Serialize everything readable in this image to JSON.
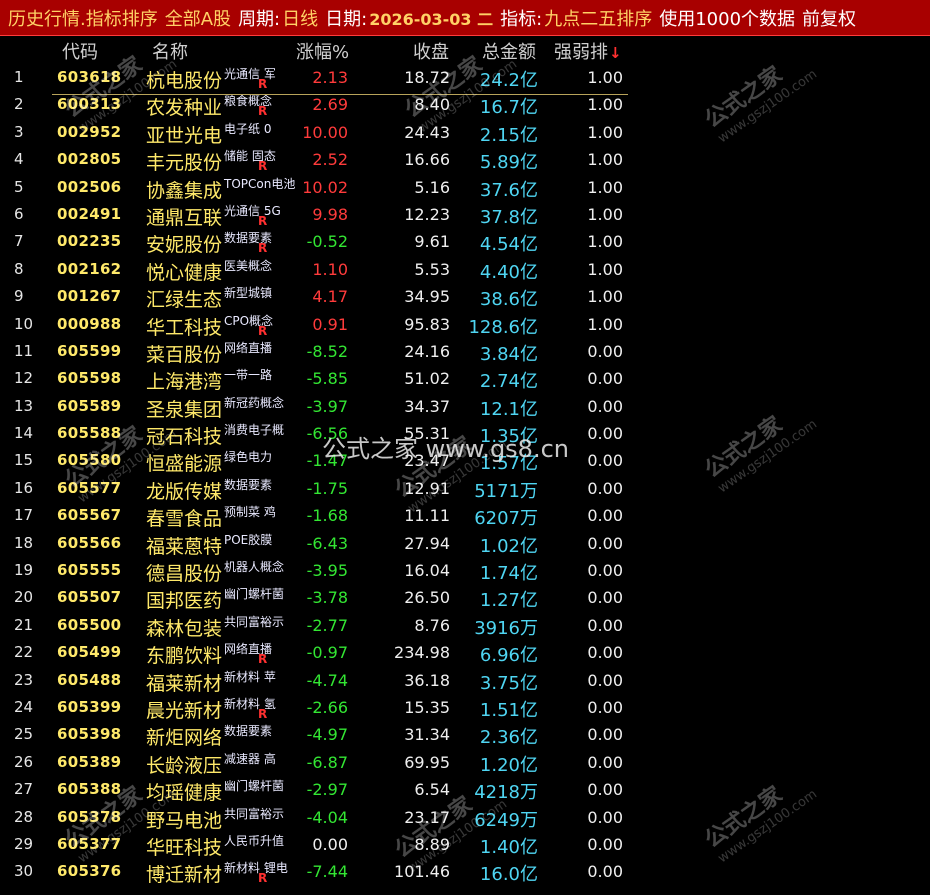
{
  "titlebar": {
    "title": "历史行情.指标排序",
    "market": "全部A股",
    "period_label": "周期:",
    "period_value": "日线",
    "date_label": "日期:",
    "date_value": "2026-03-03 二",
    "indicator_label": "指标:",
    "indicator_value": "九点二五排序",
    "data_note": "使用1000个数据",
    "adjust": "前复权"
  },
  "columns": {
    "code": "代码",
    "name": "名称",
    "change": "涨幅%",
    "close": "收盘",
    "amount": "总金额",
    "strength": "强弱排",
    "sort_arrow": "↓"
  },
  "watermark": {
    "center": "公式之家 www.gs8.cn",
    "mark_big": "公式之家",
    "mark_small": "www.gszj100.com"
  },
  "rows": [
    {
      "num": "1",
      "code": "603618",
      "name": "杭电股份",
      "concept": "光通信 军",
      "r": true,
      "change": "2.13",
      "close": "18.72",
      "amount": "24.2亿",
      "strength": "1.00",
      "dir": "up"
    },
    {
      "num": "2",
      "code": "600313",
      "name": "农发种业",
      "concept": "粮食概念",
      "r": true,
      "change": "2.69",
      "close": "8.40",
      "amount": "16.7亿",
      "strength": "1.00",
      "dir": "up"
    },
    {
      "num": "3",
      "code": "002952",
      "name": "亚世光电",
      "concept": "电子纸 0",
      "r": false,
      "change": "10.00",
      "close": "24.43",
      "amount": "2.15亿",
      "strength": "1.00",
      "dir": "up"
    },
    {
      "num": "4",
      "code": "002805",
      "name": "丰元股份",
      "concept": "储能 固态",
      "r": true,
      "change": "2.52",
      "close": "16.66",
      "amount": "5.89亿",
      "strength": "1.00",
      "dir": "up"
    },
    {
      "num": "5",
      "code": "002506",
      "name": "协鑫集成",
      "concept": "TOPCon电池",
      "r": false,
      "change": "10.02",
      "close": "5.16",
      "amount": "37.6亿",
      "strength": "1.00",
      "dir": "up"
    },
    {
      "num": "6",
      "code": "002491",
      "name": "通鼎互联",
      "concept": "光通信 5G",
      "r": true,
      "change": "9.98",
      "close": "12.23",
      "amount": "37.8亿",
      "strength": "1.00",
      "dir": "up"
    },
    {
      "num": "7",
      "code": "002235",
      "name": "安妮股份",
      "concept": "数据要素",
      "r": true,
      "change": "-0.52",
      "close": "9.61",
      "amount": "4.54亿",
      "strength": "1.00",
      "dir": "down"
    },
    {
      "num": "8",
      "code": "002162",
      "name": "悦心健康",
      "concept": "医美概念",
      "r": false,
      "change": "1.10",
      "close": "5.53",
      "amount": "4.40亿",
      "strength": "1.00",
      "dir": "up"
    },
    {
      "num": "9",
      "code": "001267",
      "name": "汇绿生态",
      "concept": "新型城镇",
      "r": false,
      "change": "4.17",
      "close": "34.95",
      "amount": "38.6亿",
      "strength": "1.00",
      "dir": "up"
    },
    {
      "num": "10",
      "code": "000988",
      "name": "华工科技",
      "concept": "CPO概念",
      "r": true,
      "change": "0.91",
      "close": "95.83",
      "amount": "128.6亿",
      "strength": "1.00",
      "dir": "up"
    },
    {
      "num": "11",
      "code": "605599",
      "name": "菜百股份",
      "concept": "网络直播",
      "r": false,
      "change": "-8.52",
      "close": "24.16",
      "amount": "3.84亿",
      "strength": "0.00",
      "dir": "down"
    },
    {
      "num": "12",
      "code": "605598",
      "name": "上海港湾",
      "concept": "一带一路",
      "r": false,
      "change": "-5.85",
      "close": "51.02",
      "amount": "2.74亿",
      "strength": "0.00",
      "dir": "down"
    },
    {
      "num": "13",
      "code": "605589",
      "name": "圣泉集团",
      "concept": "新冠药概念",
      "r": false,
      "change": "-3.97",
      "close": "34.37",
      "amount": "12.1亿",
      "strength": "0.00",
      "dir": "down"
    },
    {
      "num": "14",
      "code": "605588",
      "name": "冠石科技",
      "concept": "消费电子概",
      "r": false,
      "change": "-6.56",
      "close": "55.31",
      "amount": "1.35亿",
      "strength": "0.00",
      "dir": "down"
    },
    {
      "num": "15",
      "code": "605580",
      "name": "恒盛能源",
      "concept": "绿色电力",
      "r": false,
      "change": "-1.47",
      "close": "23.47",
      "amount": "1.57亿",
      "strength": "0.00",
      "dir": "down"
    },
    {
      "num": "16",
      "code": "605577",
      "name": "龙版传媒",
      "concept": "数据要素",
      "r": false,
      "change": "-1.75",
      "close": "12.91",
      "amount": "5171万",
      "strength": "0.00",
      "dir": "down"
    },
    {
      "num": "17",
      "code": "605567",
      "name": "春雪食品",
      "concept": "预制菜 鸡",
      "r": false,
      "change": "-1.68",
      "close": "11.11",
      "amount": "6207万",
      "strength": "0.00",
      "dir": "down"
    },
    {
      "num": "18",
      "code": "605566",
      "name": "福莱蒽特",
      "concept": "POE胶膜",
      "r": false,
      "change": "-6.43",
      "close": "27.94",
      "amount": "1.02亿",
      "strength": "0.00",
      "dir": "down"
    },
    {
      "num": "19",
      "code": "605555",
      "name": "德昌股份",
      "concept": "机器人概念",
      "r": false,
      "change": "-3.95",
      "close": "16.04",
      "amount": "1.74亿",
      "strength": "0.00",
      "dir": "down"
    },
    {
      "num": "20",
      "code": "605507",
      "name": "国邦医药",
      "concept": "幽门螺杆菌",
      "r": false,
      "change": "-3.78",
      "close": "26.50",
      "amount": "1.27亿",
      "strength": "0.00",
      "dir": "down"
    },
    {
      "num": "21",
      "code": "605500",
      "name": "森林包装",
      "concept": "共同富裕示",
      "r": false,
      "change": "-2.77",
      "close": "8.76",
      "amount": "3916万",
      "strength": "0.00",
      "dir": "down"
    },
    {
      "num": "22",
      "code": "605499",
      "name": "东鹏饮料",
      "concept": "网络直播",
      "r": true,
      "change": "-0.97",
      "close": "234.98",
      "amount": "6.96亿",
      "strength": "0.00",
      "dir": "down"
    },
    {
      "num": "23",
      "code": "605488",
      "name": "福莱新材",
      "concept": "新材料 苹",
      "r": false,
      "change": "-4.74",
      "close": "36.18",
      "amount": "3.75亿",
      "strength": "0.00",
      "dir": "down"
    },
    {
      "num": "24",
      "code": "605399",
      "name": "晨光新材",
      "concept": "新材料 氢",
      "r": true,
      "change": "-2.66",
      "close": "15.35",
      "amount": "1.51亿",
      "strength": "0.00",
      "dir": "down"
    },
    {
      "num": "25",
      "code": "605398",
      "name": "新炬网络",
      "concept": "数据要素",
      "r": false,
      "change": "-4.97",
      "close": "31.34",
      "amount": "2.36亿",
      "strength": "0.00",
      "dir": "down"
    },
    {
      "num": "26",
      "code": "605389",
      "name": "长龄液压",
      "concept": "减速器 高",
      "r": false,
      "change": "-6.87",
      "close": "69.95",
      "amount": "1.20亿",
      "strength": "0.00",
      "dir": "down"
    },
    {
      "num": "27",
      "code": "605388",
      "name": "均瑶健康",
      "concept": "幽门螺杆菌",
      "r": false,
      "change": "-2.97",
      "close": "6.54",
      "amount": "4218万",
      "strength": "0.00",
      "dir": "down"
    },
    {
      "num": "28",
      "code": "605378",
      "name": "野马电池",
      "concept": "共同富裕示",
      "r": false,
      "change": "-4.04",
      "close": "23.17",
      "amount": "6249万",
      "strength": "0.00",
      "dir": "down"
    },
    {
      "num": "29",
      "code": "605377",
      "name": "华旺科技",
      "concept": "人民币升值",
      "r": false,
      "change": "0.00",
      "close": "8.89",
      "amount": "1.40亿",
      "strength": "0.00",
      "dir": "flat"
    },
    {
      "num": "30",
      "code": "605376",
      "name": "博迁新材",
      "concept": "新材料 锂电",
      "r": true,
      "change": "-7.44",
      "close": "101.46",
      "amount": "16.0亿",
      "strength": "0.00",
      "dir": "down"
    }
  ]
}
